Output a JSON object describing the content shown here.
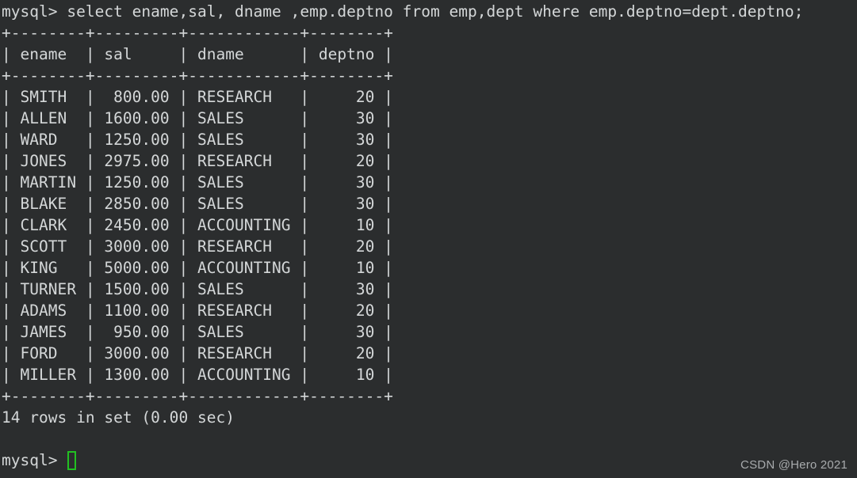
{
  "terminal": {
    "background_color": "#2b2d2e",
    "text_color": "#d4d7d8",
    "cursor_color": "#22c022",
    "prompt": "mysql> ",
    "command": "select ename,sal, dname ,emp.deptno from emp,dept where emp.deptno=dept.deptno;",
    "command_line": "mysql> select ename,sal, dname ,emp.deptno from emp,dept where emp.deptno=dept.deptno;",
    "result_status": "14 rows in set (0.00 sec)",
    "final_prompt": "mysql> ",
    "blank_line": " "
  },
  "table": {
    "border": "+--------+---------+------------+--------+",
    "header_row": "| ename  | sal     | dname      | deptno |",
    "columns": [
      {
        "name": "ename",
        "align": "left",
        "width": 6
      },
      {
        "name": "sal",
        "align": "right",
        "width": 7
      },
      {
        "name": "dname",
        "align": "left",
        "width": 10
      },
      {
        "name": "deptno",
        "align": "right",
        "width": 6
      }
    ],
    "rows": [
      {
        "ename": "SMITH",
        "sal": "800.00",
        "dname": "RESEARCH",
        "deptno": "20",
        "line": "| SMITH  |  800.00 | RESEARCH   |     20 |"
      },
      {
        "ename": "ALLEN",
        "sal": "1600.00",
        "dname": "SALES",
        "deptno": "30",
        "line": "| ALLEN  | 1600.00 | SALES      |     30 |"
      },
      {
        "ename": "WARD",
        "sal": "1250.00",
        "dname": "SALES",
        "deptno": "30",
        "line": "| WARD   | 1250.00 | SALES      |     30 |"
      },
      {
        "ename": "JONES",
        "sal": "2975.00",
        "dname": "RESEARCH",
        "deptno": "20",
        "line": "| JONES  | 2975.00 | RESEARCH   |     20 |"
      },
      {
        "ename": "MARTIN",
        "sal": "1250.00",
        "dname": "SALES",
        "deptno": "30",
        "line": "| MARTIN | 1250.00 | SALES      |     30 |"
      },
      {
        "ename": "BLAKE",
        "sal": "2850.00",
        "dname": "SALES",
        "deptno": "30",
        "line": "| BLAKE  | 2850.00 | SALES      |     30 |"
      },
      {
        "ename": "CLARK",
        "sal": "2450.00",
        "dname": "ACCOUNTING",
        "deptno": "10",
        "line": "| CLARK  | 2450.00 | ACCOUNTING |     10 |"
      },
      {
        "ename": "SCOTT",
        "sal": "3000.00",
        "dname": "RESEARCH",
        "deptno": "20",
        "line": "| SCOTT  | 3000.00 | RESEARCH   |     20 |"
      },
      {
        "ename": "KING",
        "sal": "5000.00",
        "dname": "ACCOUNTING",
        "deptno": "10",
        "line": "| KING   | 5000.00 | ACCOUNTING |     10 |"
      },
      {
        "ename": "TURNER",
        "sal": "1500.00",
        "dname": "SALES",
        "deptno": "30",
        "line": "| TURNER | 1500.00 | SALES      |     30 |"
      },
      {
        "ename": "ADAMS",
        "sal": "1100.00",
        "dname": "RESEARCH",
        "deptno": "20",
        "line": "| ADAMS  | 1100.00 | RESEARCH   |     20 |"
      },
      {
        "ename": "JAMES",
        "sal": "950.00",
        "dname": "SALES",
        "deptno": "30",
        "line": "| JAMES  |  950.00 | SALES      |     30 |"
      },
      {
        "ename": "FORD",
        "sal": "3000.00",
        "dname": "RESEARCH",
        "deptno": "20",
        "line": "| FORD   | 3000.00 | RESEARCH   |     20 |"
      },
      {
        "ename": "MILLER",
        "sal": "1300.00",
        "dname": "ACCOUNTING",
        "deptno": "10",
        "line": "| MILLER | 1300.00 | ACCOUNTING |     10 |"
      }
    ],
    "row_count": 14
  },
  "watermark": {
    "text": "CSDN @Hero 2021"
  }
}
